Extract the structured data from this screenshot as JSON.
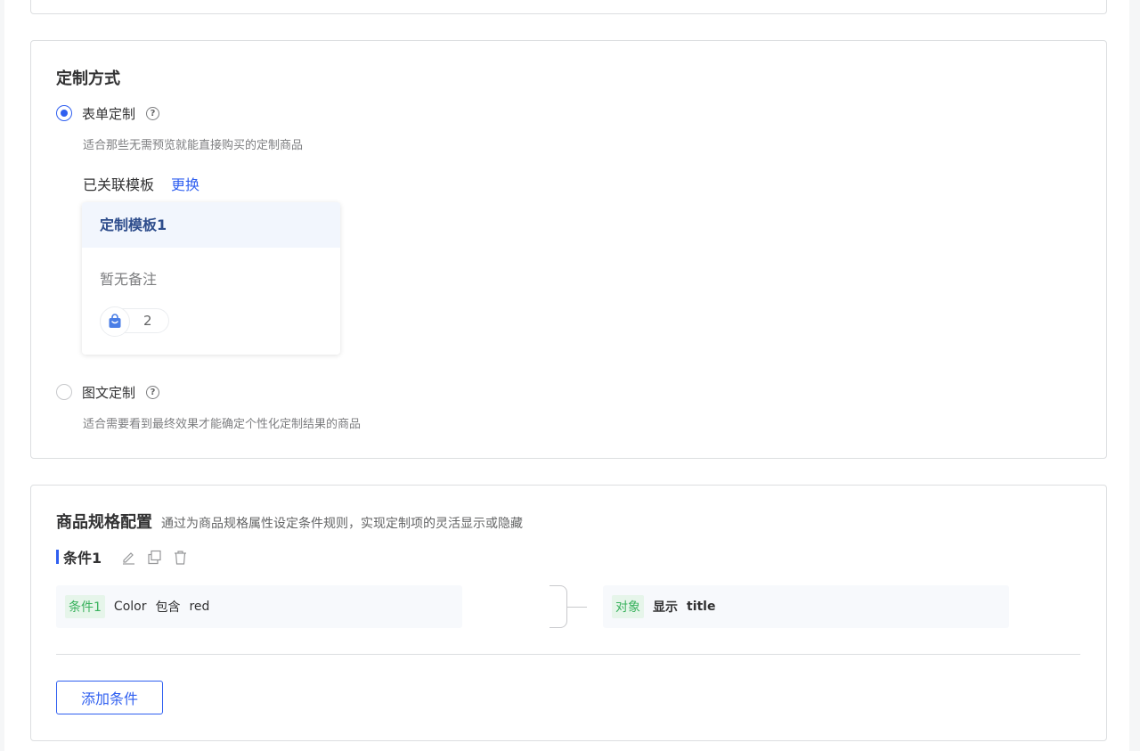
{
  "mode_section": {
    "title": "定制方式",
    "options": [
      {
        "label": "表单定制",
        "desc": "适合那些无需预览就能直接购买的定制商品",
        "checked": true
      },
      {
        "label": "图文定制",
        "desc": "适合需要看到最终效果才能确定个性化定制结果的商品",
        "checked": false
      }
    ],
    "linked_label": "已关联模板",
    "change_label": "更换",
    "template": {
      "name": "定制模板1",
      "note": "暂无备注",
      "product_count": "2",
      "icon": "shopping-bag-icon"
    }
  },
  "spec_section": {
    "title": "商品规格配置",
    "subtitle": "通过为商品规格属性设定条件规则，实现定制项的灵活显示或隐藏",
    "condition": {
      "name": "条件1",
      "rule": {
        "tag": "条件1",
        "attribute": "Color",
        "operator": "包含",
        "value": "red"
      },
      "target": {
        "tag": "对象",
        "action": "显示",
        "field": "title"
      }
    },
    "add_label": "添加条件"
  },
  "colors": {
    "accent": "#2f5ff0",
    "tag_green": "#3ab25e"
  }
}
